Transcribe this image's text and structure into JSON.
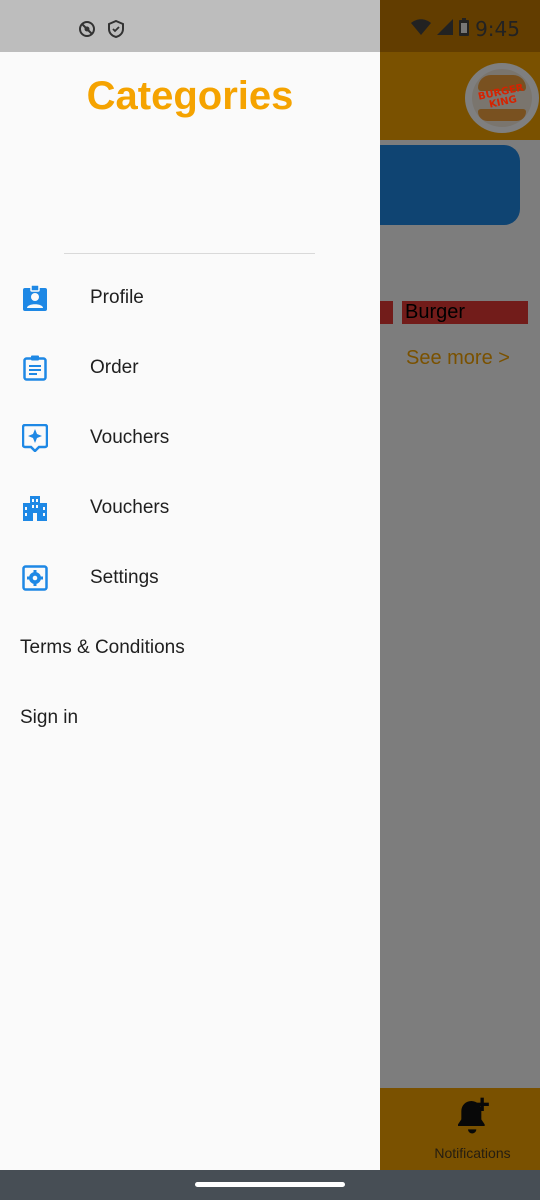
{
  "status_bar": {
    "time": "9:45",
    "left_icons": [
      "vpn-icon",
      "shield-icon"
    ],
    "right_icons": [
      "wifi-icon",
      "signal-icon",
      "battery-icon"
    ]
  },
  "background_app": {
    "logo_text": "BURGER\nKING",
    "category_tag": "Burger",
    "see_more": "See more >",
    "bottom_nav": {
      "notifications_label": "Notifications",
      "icon": "bell-plus-icon"
    },
    "colors": {
      "primary": "#f5a300",
      "banner": "#1e88e5",
      "tag": "#e53935"
    }
  },
  "drawer": {
    "title": "Categories",
    "items": [
      {
        "label": "Profile",
        "icon": "profile-badge-icon"
      },
      {
        "label": "Order",
        "icon": "clipboard-icon"
      },
      {
        "label": "Vouchers",
        "icon": "sparkle-badge-icon"
      },
      {
        "label": "Vouchers",
        "icon": "buildings-icon"
      },
      {
        "label": "Settings",
        "icon": "gear-square-icon"
      },
      {
        "label": "Terms & Conditions",
        "icon": null
      },
      {
        "label": "Sign in",
        "icon": null
      }
    ],
    "colors": {
      "title": "#f5a300",
      "icon": "#1e88e5"
    }
  }
}
